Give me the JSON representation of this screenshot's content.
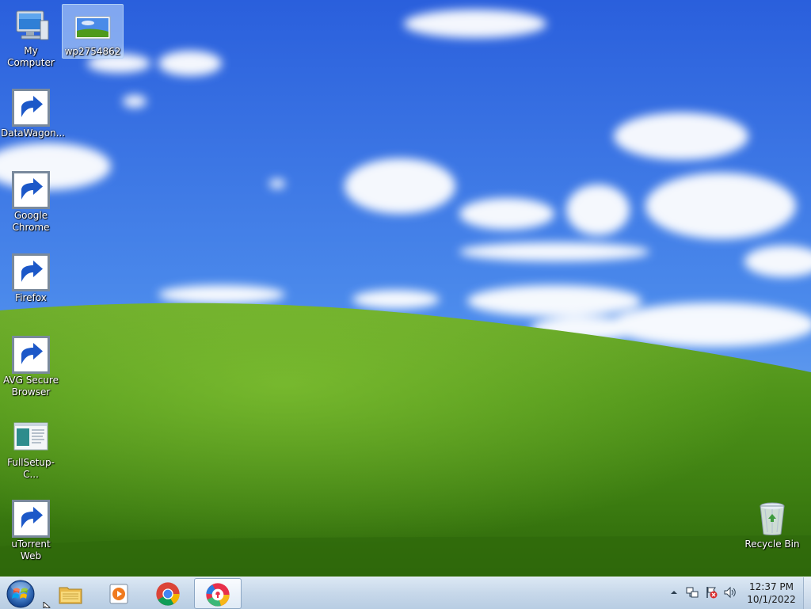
{
  "desktop": {
    "icons": [
      {
        "label": "My Computer",
        "icon": "computer-icon"
      },
      {
        "label": "wp2754862",
        "icon": "image-file-icon"
      },
      {
        "label": "DataWagon...",
        "icon": "datawagon-icon"
      },
      {
        "label": "Google Chrome",
        "icon": "chrome-icon"
      },
      {
        "label": "Firefox",
        "icon": "firefox-icon"
      },
      {
        "label": "AVG Secure Browser",
        "icon": "avg-browser-icon"
      },
      {
        "label": "FullSetup-C...",
        "icon": "setup-file-icon"
      },
      {
        "label": "uTorrent Web",
        "icon": "utorrent-icon"
      },
      {
        "label": "Recycle Bin",
        "icon": "recycle-bin-icon"
      }
    ]
  },
  "taskbar": {
    "start": "start-orb-icon",
    "pinned": [
      "file-explorer-icon",
      "media-player-icon",
      "chrome-icon",
      "avg-browser-icon"
    ],
    "active_index": 3,
    "tray": [
      "show-hidden-icon",
      "network-icon",
      "action-center-icon",
      "volume-icon"
    ],
    "clock": {
      "time": "12:37 PM",
      "date": "10/1/2022"
    }
  },
  "colors": {
    "sky_top": "#2a64e0",
    "sky_bottom": "#7fb2f0",
    "hill": "#4d8f1c",
    "taskbar": "#c7d8ea"
  }
}
